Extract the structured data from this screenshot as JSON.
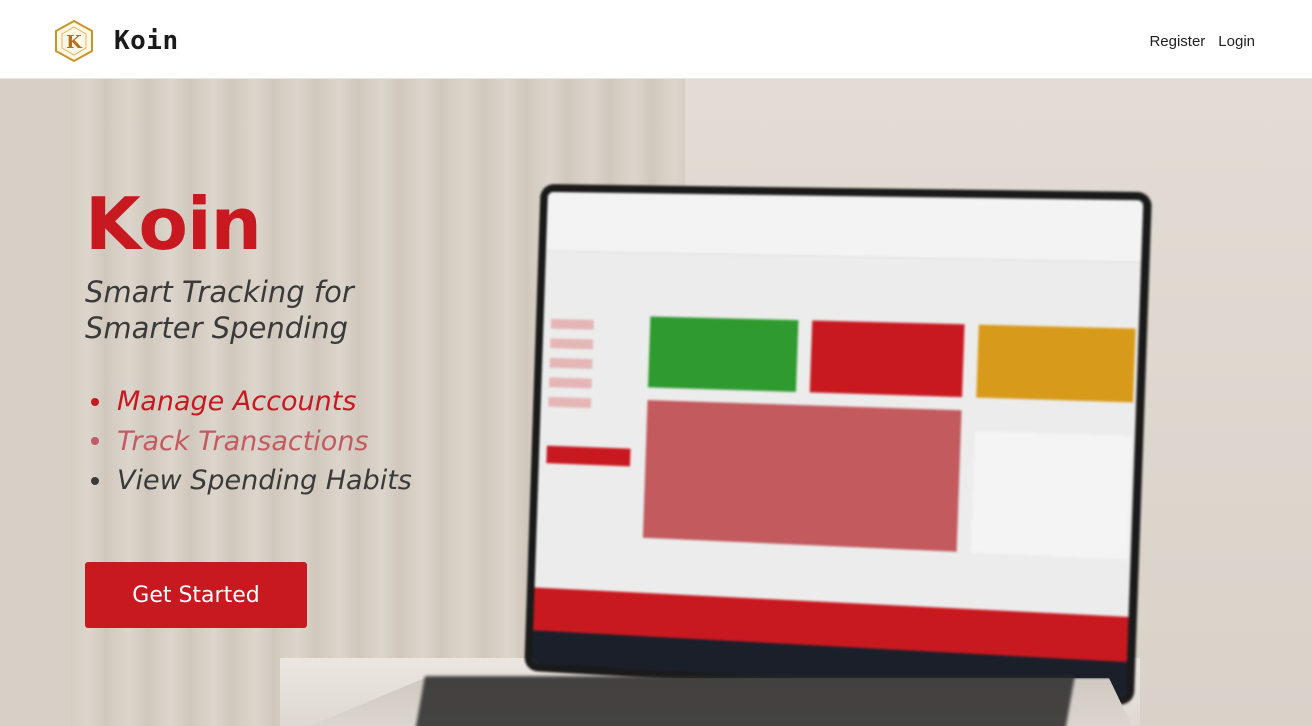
{
  "nav": {
    "brand_name": "Koin",
    "logo_letter": "K",
    "links": [
      "Register",
      "Login"
    ]
  },
  "hero": {
    "title": "Koin",
    "tagline": "Smart Tracking for Smarter Spending",
    "features": [
      "Manage Accounts",
      "Track Transactions",
      "View Spending Habits"
    ],
    "cta_label": "Get Started"
  },
  "colors": {
    "brand_red": "#c81921",
    "feature_faded": "#c45a62",
    "text_dark": "#3a3a3a",
    "logo_gold": "#c9962b"
  }
}
